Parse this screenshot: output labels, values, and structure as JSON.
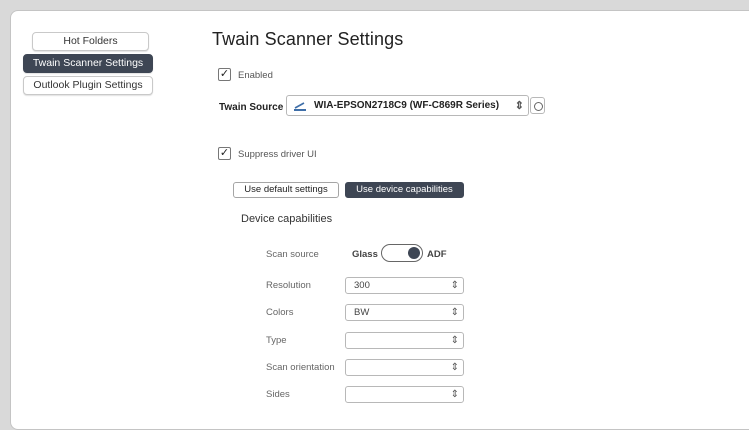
{
  "sidebar": {
    "items": [
      {
        "label": "Hot Folders",
        "active": false
      },
      {
        "label": "Twain Scanner Settings",
        "active": true
      },
      {
        "label": "Outlook Plugin Settings",
        "active": false
      }
    ]
  },
  "main": {
    "title": "Twain Scanner Settings",
    "enabled": {
      "label": "Enabled",
      "checked": true
    },
    "twain_source": {
      "label": "Twain Source",
      "value": "WIA-EPSON2718C9 (WF-C869R Series)",
      "icon": "scanner-icon"
    },
    "suppress_ui": {
      "label": "Suppress driver UI",
      "checked": true
    },
    "mode_buttons": {
      "default_label": "Use default settings",
      "device_label": "Use device capabilities",
      "selected": "device"
    },
    "device_capabilities": {
      "title": "Device capabilities",
      "scan_source": {
        "label": "Scan source",
        "off_label": "Glass",
        "on_label": "ADF",
        "value": "ADF"
      },
      "resolution": {
        "label": "Resolution",
        "value": "300"
      },
      "colors": {
        "label": "Colors",
        "value": "BW"
      },
      "type": {
        "label": "Type",
        "value": ""
      },
      "scan_orientation": {
        "label": "Scan orientation",
        "value": ""
      },
      "sides": {
        "label": "Sides",
        "value": ""
      }
    }
  },
  "colors": {
    "accent": "#3e4654",
    "background": "#ffffff",
    "outer": "#d9d9d9"
  }
}
